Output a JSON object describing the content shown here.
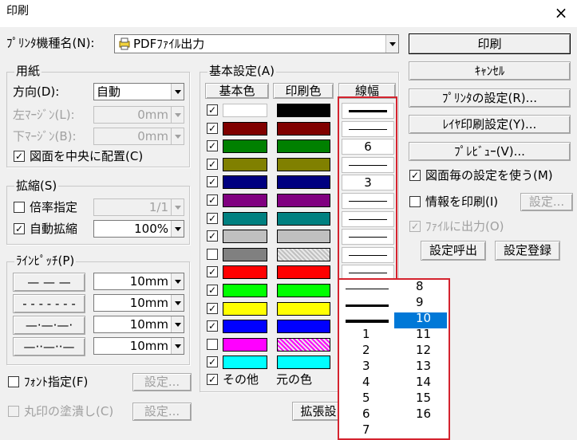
{
  "window": {
    "title": "印刷",
    "close": "×"
  },
  "printer": {
    "label": "ﾌﾟﾘﾝﾀ機種名(N):",
    "value": "PDFﾌｧｲﾙ出力"
  },
  "paper": {
    "title": "用紙",
    "direction_label": "方向(D):",
    "direction_value": "自動",
    "left_margin_label": "左ﾏｰｼﾞﾝ(L):",
    "left_margin_value": "0mm",
    "bottom_margin_label": "下ﾏｰｼﾞﾝ(B):",
    "bottom_margin_value": "0mm",
    "center_label": "図面を中央に配置(C)",
    "center_checked": true
  },
  "scale": {
    "title": "拡縮(S)",
    "ratio_label": "倍率指定",
    "ratio_checked": false,
    "ratio_value": "1/1",
    "auto_label": "自動拡縮",
    "auto_checked": true,
    "auto_value": "100%"
  },
  "linepitch": {
    "title": "ﾗｲﾝﾋﾟｯﾁ(P)",
    "rows": [
      {
        "button": "— — —",
        "value": "10mm"
      },
      {
        "button": "- - - - - - -",
        "value": "10mm"
      },
      {
        "button": "—·—·—·",
        "value": "10mm"
      },
      {
        "button": "—··—··—",
        "value": "10mm"
      }
    ]
  },
  "font": {
    "label": "ﾌｫﾝﾄ指定(F)",
    "checked": false,
    "settings": "設定..."
  },
  "fillcircle": {
    "label": "丸印の塗潰し(C)",
    "checked": false,
    "settings": "設定..."
  },
  "basic": {
    "title": "基本設定(A)",
    "col_base": "基本色",
    "col_print": "印刷色",
    "col_width": "線幅",
    "rows": [
      {
        "checked": true,
        "color": "#ffffff",
        "print": "#000000",
        "width": 2,
        "label": ""
      },
      {
        "checked": true,
        "color": "#800000",
        "print": "#800000",
        "width": 1,
        "label": ""
      },
      {
        "checked": true,
        "color": "#008000",
        "print": "#008000",
        "width": 0,
        "label": "6"
      },
      {
        "checked": true,
        "color": "#808000",
        "print": "#808000",
        "width": 1,
        "label": ""
      },
      {
        "checked": true,
        "color": "#000080",
        "print": "#000080",
        "width": 0,
        "label": "3"
      },
      {
        "checked": true,
        "color": "#800080",
        "print": "#800080",
        "width": 1,
        "label": ""
      },
      {
        "checked": true,
        "color": "#008080",
        "print": "#008080",
        "width": 1,
        "label": ""
      },
      {
        "checked": true,
        "color": "#c0c0c0",
        "print": "#c0c0c0",
        "width": 1,
        "label": ""
      },
      {
        "checked": false,
        "color": "#808080",
        "print": "#c0c0c0",
        "width": 1,
        "label": ""
      },
      {
        "checked": true,
        "color": "#ff0000",
        "print": "#ff0000",
        "width": 1,
        "label": ""
      },
      {
        "checked": true,
        "color": "#00ff00",
        "print": "#00ff00",
        "width": 1,
        "label": ""
      },
      {
        "checked": true,
        "color": "#ffff00",
        "print": "#ffff00",
        "width": 1,
        "label": ""
      },
      {
        "checked": true,
        "color": "#0000ff",
        "print": "#0000ff",
        "width": 1,
        "label": ""
      },
      {
        "checked": false,
        "color": "#ff00ff",
        "print": "#ff00ff",
        "width": 1,
        "label": ""
      },
      {
        "checked": true,
        "color": "#00ffff",
        "print": "#00ffff",
        "width": 1,
        "label": ""
      }
    ],
    "other_label": "その他",
    "other_checked": true,
    "original_color": "元の色",
    "extend_button": "拡張設"
  },
  "buttons": {
    "print": "印刷",
    "cancel": "ｷｬﾝｾﾙ",
    "printer_settings": "ﾌﾟﾘﾝﾀの設定(R)...",
    "layer_print": "ﾚｲﾔ印刷設定(Y)...",
    "preview": "ﾌﾟﾚﾋﾞｭｰ(V)...",
    "call_settings": "設定呼出",
    "save_settings": "設定登録"
  },
  "options": {
    "per_drawing": "図面毎の設定を使う(M)",
    "per_drawing_checked": true,
    "print_info": "情報を印刷(I)",
    "print_info_checked": false,
    "info_settings": "設定...",
    "file_output": "ﾌｧｲﾙに出力(O)",
    "file_output_checked": true
  },
  "linewidth_popup": {
    "left_items": [
      "1",
      "2",
      "3",
      "4",
      "5",
      "6",
      "7"
    ],
    "right_items": [
      "8",
      "9",
      "10",
      "11",
      "12",
      "13",
      "14",
      "15",
      "16"
    ],
    "selected": "10"
  },
  "colors": {
    "highlight": "#d4232e",
    "selection": "#0078d7"
  }
}
